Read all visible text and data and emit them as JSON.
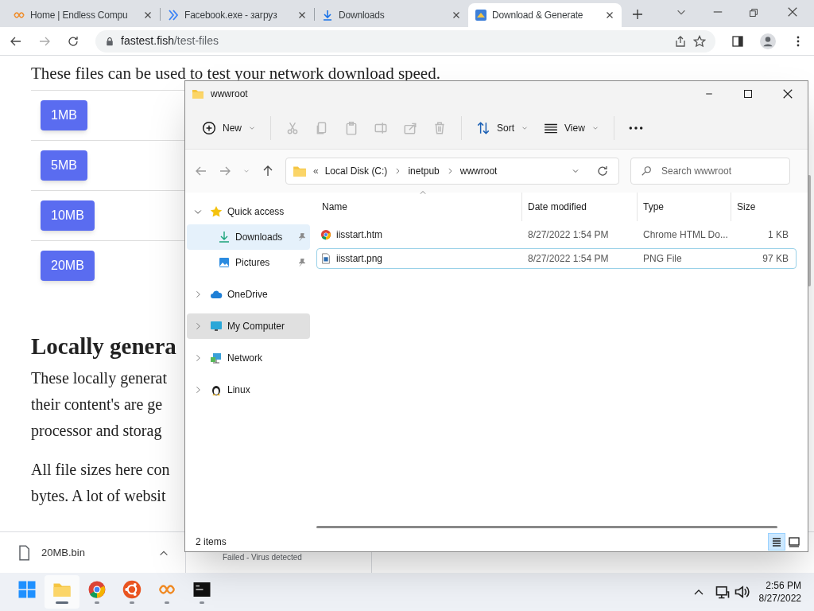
{
  "browser": {
    "tabs": [
      {
        "title": "Home | Endless Compu",
        "kind": "infinity",
        "selected": false
      },
      {
        "title": "Facebook.exe - загруз",
        "kind": "chevrons",
        "selected": false
      },
      {
        "title": "Downloads",
        "kind": "download",
        "selected": false
      },
      {
        "title": "Download & Generate",
        "kind": "site",
        "selected": true
      }
    ],
    "address": {
      "host": "fastest.fish",
      "path": "/test-files"
    }
  },
  "page": {
    "intro": "These files can be used to test your network download speed.",
    "files": [
      "1MB",
      "5MB",
      "10MB",
      "20MB"
    ],
    "heading": "Locally genera",
    "paragraphs": [
      [
        "These locally generat",
        "their content's are ge",
        "processor and storag"
      ],
      [
        "All file sizes here con",
        "bytes. A lot of websit"
      ]
    ]
  },
  "explorer": {
    "title": "wwwroot",
    "toolbar": [
      {
        "kind": "new",
        "label": "New",
        "disabled": false
      },
      {
        "kind": "cut",
        "disabled": true
      },
      {
        "kind": "copy",
        "disabled": true
      },
      {
        "kind": "paste",
        "disabled": true
      },
      {
        "kind": "rename",
        "disabled": true
      },
      {
        "kind": "share",
        "disabled": true
      },
      {
        "kind": "delete",
        "disabled": true
      },
      {
        "kind": "sort",
        "label": "Sort",
        "disabled": false
      },
      {
        "kind": "view",
        "label": "View",
        "disabled": false
      },
      {
        "kind": "more",
        "disabled": false
      }
    ],
    "breadcrumb_overflow": "«",
    "breadcrumb": [
      "Local Disk (C:)",
      "inetpub",
      "wwwroot"
    ],
    "search": {
      "placeholder": "Search wwwroot"
    },
    "tree": [
      {
        "label": "Quick access",
        "kind": "star",
        "expanded": true,
        "selected": false,
        "hovered": false,
        "children": [
          {
            "label": "Downloads",
            "kind": "download",
            "selected": false,
            "hovered": true,
            "pinned": true
          },
          {
            "label": "Pictures",
            "kind": "pictures",
            "selected": false,
            "hovered": false,
            "pinned": true
          }
        ]
      },
      {
        "label": "OneDrive",
        "kind": "cloud",
        "expanded": false,
        "selected": false,
        "hovered": false
      },
      {
        "label": "My Computer",
        "kind": "monitor",
        "expanded": false,
        "selected": true,
        "hovered": false
      },
      {
        "label": "Network",
        "kind": "network",
        "expanded": false,
        "selected": false,
        "hovered": false
      },
      {
        "label": "Linux",
        "kind": "penguin",
        "expanded": false,
        "selected": false,
        "hovered": false
      }
    ],
    "columns": [
      {
        "label": "Name",
        "sorted": true
      },
      {
        "label": "Date modified",
        "sorted": false
      },
      {
        "label": "Type",
        "sorted": false
      },
      {
        "label": "Size",
        "sorted": false
      }
    ],
    "files": [
      {
        "name": "iisstart.htm",
        "kind": "chrome",
        "modified": "8/27/2022 1:54 PM",
        "type": "Chrome HTML Do...",
        "size": "1 KB",
        "selected": false
      },
      {
        "name": "iisstart.png",
        "kind": "image",
        "modified": "8/27/2022 1:54 PM",
        "type": "PNG File",
        "size": "97 KB",
        "selected": true
      }
    ],
    "status": "2 items",
    "views": [
      {
        "kind": "details",
        "selected": true
      },
      {
        "kind": "tiles",
        "selected": false
      }
    ]
  },
  "download_bar": {
    "items": [
      {
        "kind": "file",
        "name": "20MB.bin"
      },
      {
        "kind": "failed",
        "status": "Failed - Virus detected"
      }
    ]
  },
  "taskbar": {
    "apps": [
      {
        "kind": "start",
        "active": false,
        "running": false
      },
      {
        "kind": "explorer",
        "active": true,
        "running": true
      },
      {
        "kind": "chrome",
        "active": false,
        "running": true
      },
      {
        "kind": "ubuntu",
        "active": false,
        "running": true
      },
      {
        "kind": "infinity",
        "active": false,
        "running": true
      },
      {
        "kind": "terminal",
        "active": false,
        "running": true
      }
    ],
    "time": "2:56 PM",
    "date": "8/27/2022"
  }
}
